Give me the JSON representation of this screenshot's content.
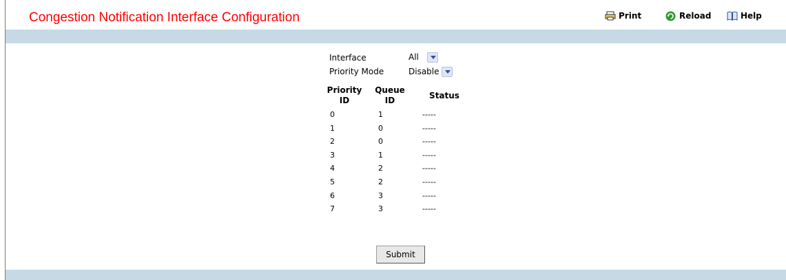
{
  "page": {
    "title": "Congestion Notification Interface Configuration"
  },
  "toolbar": {
    "print_label": "Print",
    "reload_label": "Reload",
    "help_label": "Help"
  },
  "form": {
    "interface_label": "Interface",
    "interface_value": "All",
    "priority_mode_label": "Priority Mode",
    "priority_mode_value": "Disable"
  },
  "table": {
    "headers": {
      "priority": "Priority ID",
      "queue": "Queue ID",
      "status": "Status"
    },
    "rows": [
      {
        "priority": "0",
        "queue": "1",
        "status": "-----"
      },
      {
        "priority": "1",
        "queue": "0",
        "status": "-----"
      },
      {
        "priority": "2",
        "queue": "0",
        "status": "-----"
      },
      {
        "priority": "3",
        "queue": "1",
        "status": "-----"
      },
      {
        "priority": "4",
        "queue": "2",
        "status": "-----"
      },
      {
        "priority": "5",
        "queue": "2",
        "status": "-----"
      },
      {
        "priority": "6",
        "queue": "3",
        "status": "-----"
      },
      {
        "priority": "7",
        "queue": "3",
        "status": "-----"
      }
    ]
  },
  "submit_label": "Submit",
  "colors": {
    "title": "#ff0000",
    "band": "#c6d9e5",
    "accent": "#2d4fa1"
  }
}
